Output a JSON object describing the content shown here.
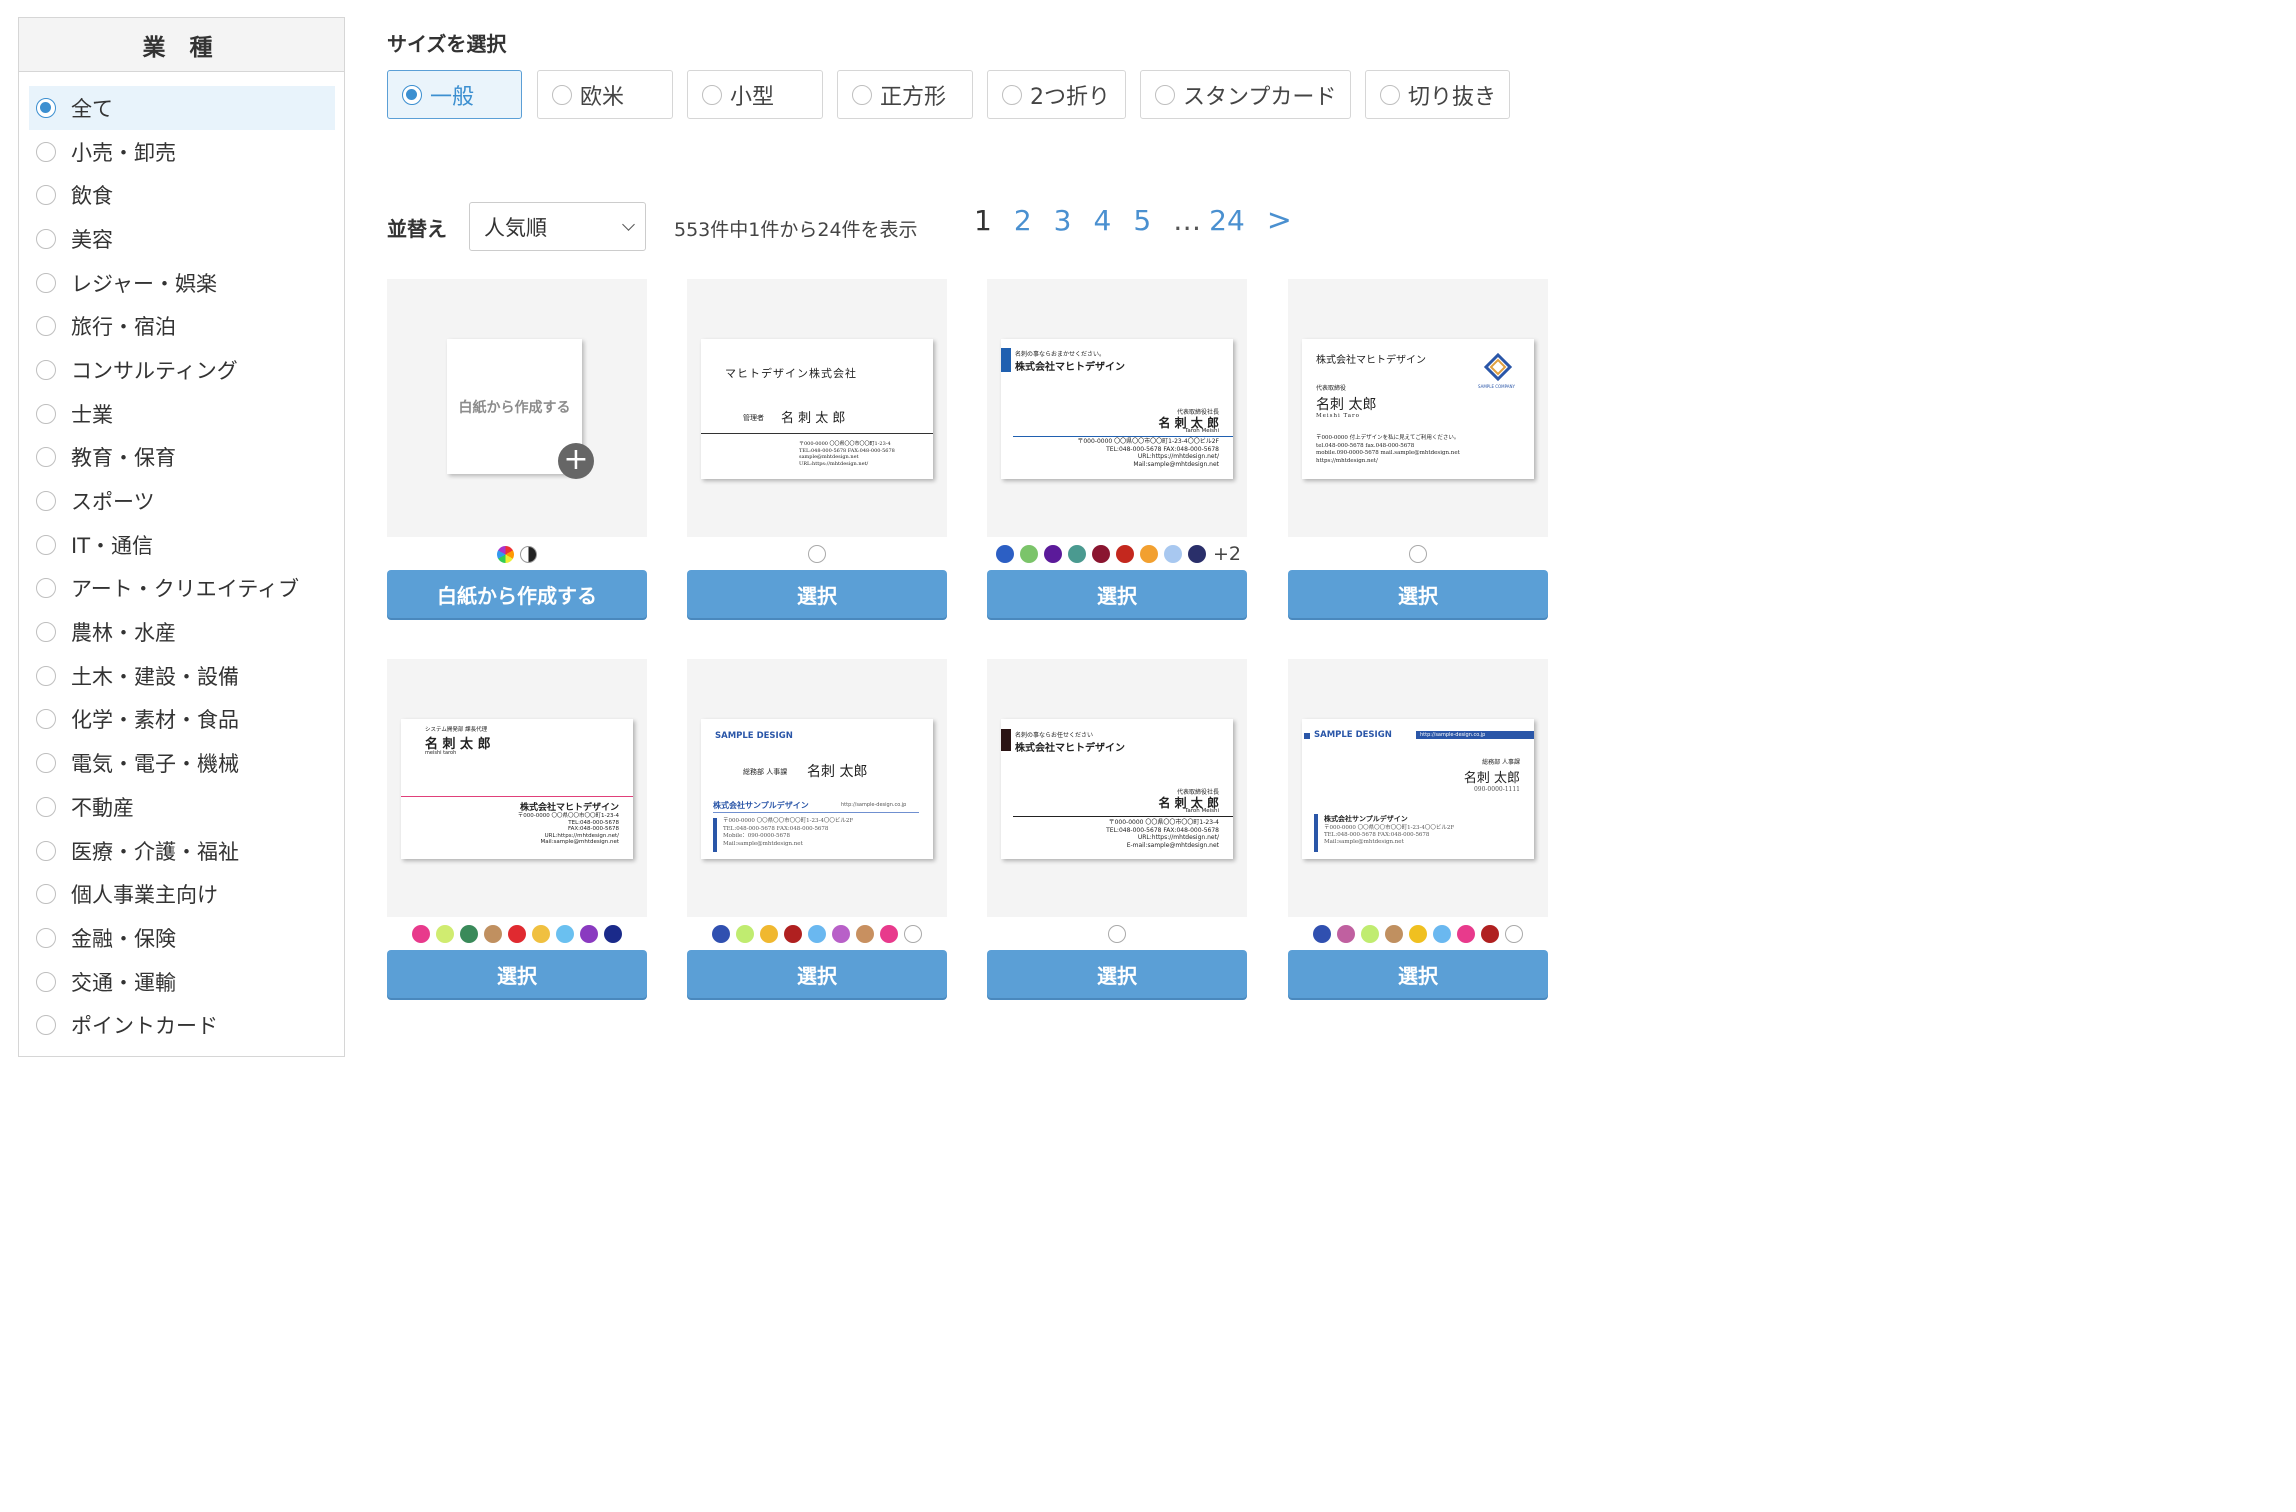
{
  "sidebar": {
    "title": "業 種",
    "items": [
      {
        "label": "全て",
        "selected": true
      },
      {
        "label": "小売・卸売"
      },
      {
        "label": "飲食"
      },
      {
        "label": "美容"
      },
      {
        "label": "レジャー・娯楽"
      },
      {
        "label": "旅行・宿泊"
      },
      {
        "label": "コンサルティング"
      },
      {
        "label": "士業"
      },
      {
        "label": "教育・保育"
      },
      {
        "label": "スポーツ"
      },
      {
        "label": "IT・通信"
      },
      {
        "label": "アート・クリエイティブ"
      },
      {
        "label": "農林・水産"
      },
      {
        "label": "土木・建設・設備"
      },
      {
        "label": "化学・素材・食品"
      },
      {
        "label": "電気・電子・機械"
      },
      {
        "label": "不動産"
      },
      {
        "label": "医療・介護・福祉"
      },
      {
        "label": "個人事業主向け"
      },
      {
        "label": "金融・保険"
      },
      {
        "label": "交通・運輸"
      },
      {
        "label": "ポイントカード"
      }
    ]
  },
  "size": {
    "title": "サイズを選択",
    "options": [
      "一般",
      "欧米",
      "小型",
      "正方形",
      "2つ折り",
      "スタンプカード",
      "切り抜き"
    ],
    "selected": "一般"
  },
  "sort": {
    "label": "並替え",
    "value": "人気順"
  },
  "results": {
    "summary": "553件中1件から24件を表示"
  },
  "pagination": {
    "current": "1",
    "pages": [
      "2",
      "3",
      "4",
      "5"
    ],
    "ellipsis": "…",
    "last": "24",
    "next": ">"
  },
  "colors": {
    "accent": "#5b9fd6",
    "link": "#4a90d0",
    "selected_bg": "#eaf4fb"
  },
  "templates": {
    "blank": {
      "paper_label": "白紙から作成する",
      "button": "白紙から作成する",
      "plus": "+"
    },
    "select_label": "選択",
    "cards": [
      {
        "id": "t1",
        "company": "マヒトデザイン株式会社",
        "role": "管理者",
        "name": "名 刺 太 郎",
        "address": [
          "〒000-0000 〇〇県〇〇市〇〇町1-23-4",
          "TEL:048-000-5678 FAX:048-000-5678",
          "sample@mhtdesign.net",
          "URL:https://mhtdesign.net/"
        ],
        "swatches": [
          "empty"
        ]
      },
      {
        "id": "t2",
        "tagline": "名刺の事ならおまかせください。",
        "company": "株式会社マヒトデザイン",
        "role": "代表取締役社長",
        "name": "名 刺 太 郎",
        "romaji": "Taroh Meishi",
        "address": [
          "〒000-0000 〇〇県〇〇市〇〇町1-23-4〇〇ビル2F",
          "TEL:048-000-5678 FAX:048-000-5678",
          "URL:https://mhtdesign.net/",
          "Mail:sample@mhtdesign.net"
        ],
        "swatches": [
          "#2c5fc4",
          "#7bc46a",
          "#5b1a9a",
          "#4a9a90",
          "#8a1530",
          "#c4281e",
          "#f2a030",
          "#a8c8f0",
          "#2a2f6a"
        ],
        "more": "+2"
      },
      {
        "id": "t3",
        "company": "株式会社マヒトデザイン",
        "role": "代表取締役",
        "name": "名刺 太郎",
        "romaji": "Meishi Taro",
        "logo_text": "SAMPLE COMPANY",
        "address": [
          "〒000-0000 付上デザインを私に見えてご利用ください。",
          "tel.048-000-5678 fax.048-000-5678",
          "mobile.090-0000-5678 mail.sample@mhtdesign.net",
          "https://mhtdesign.net/"
        ],
        "swatches": [
          "empty"
        ]
      },
      {
        "id": "t4",
        "role": "システム開発部 課長代理",
        "name": "名 刺 太 郎",
        "romaji": "meishi taroh",
        "company": "株式会社マヒトデザイン",
        "address": [
          "〒000-0000 〇〇県〇〇市〇〇町1-23-4",
          "TEL:048-000-5678",
          "FAX:048-000-5678",
          "URL:https://mhtdesign.net/",
          "Mail:sample@mhtdesign.net"
        ],
        "swatches": [
          "#e83a8c",
          "#d0ec70",
          "#3a8a5a",
          "#c09060",
          "#e02a30",
          "#f0c040",
          "#6ac0f0",
          "#8a3ac0",
          "#1a2a8a"
        ]
      },
      {
        "id": "t5",
        "brand": "SAMPLE DESIGN",
        "role": "総務部 人事課",
        "name": "名刺 太郎",
        "company": "株式会社サンプルデザイン",
        "url": "http://sample-design.co.jp",
        "address": [
          "〒000-0000 〇〇県〇〇市〇〇町1-23-4〇〇ビル2F",
          "TEL:048-000-5678 FAX:048-000-5678",
          "Mobile：090-0000-5678",
          "Mail:sample@mhtdesign.net"
        ],
        "swatches": [
          "#3050b0",
          "#c0ec70",
          "#f0b830",
          "#b02020",
          "#6ab8f0",
          "#b860c8",
          "#c89060",
          "#e83a8c",
          "empty"
        ]
      },
      {
        "id": "t6",
        "tagline": "名刺の事ならお任せください",
        "company": "株式会社マヒトデザイン",
        "role": "代表取締役社長",
        "name": "名 刺 太 郎",
        "romaji": "Taroh Meishi",
        "address": [
          "〒000-0000 〇〇県〇〇市〇〇町1-23-4",
          "TEL:048-000-5678 FAX:048-000-5678",
          "URL:https://mhtdesign.net/",
          "E-mail:sample@mhtdesign.net"
        ],
        "swatches": [
          "empty"
        ]
      },
      {
        "id": "t7",
        "brand": "SAMPLE DESIGN",
        "url": "http://sample-design.co.jp",
        "role": "総務部 人事課",
        "name": "名刺 太郎",
        "mobile": "090-0000-1111",
        "company": "株式会社サンプルデザイン",
        "address": [
          "〒000-0000 〇〇県〇〇市〇〇町1-23-4〇〇ビル2F",
          "TEL:048-000-5678 FAX:048-000-5678",
          "Mail:sample@mhtdesign.net"
        ],
        "swatches": [
          "#3050b0",
          "#c060a0",
          "#c0ec70",
          "#c09060",
          "#f0c020",
          "#6ab8f0",
          "#e83a8c",
          "#b02020",
          "empty"
        ]
      }
    ]
  }
}
